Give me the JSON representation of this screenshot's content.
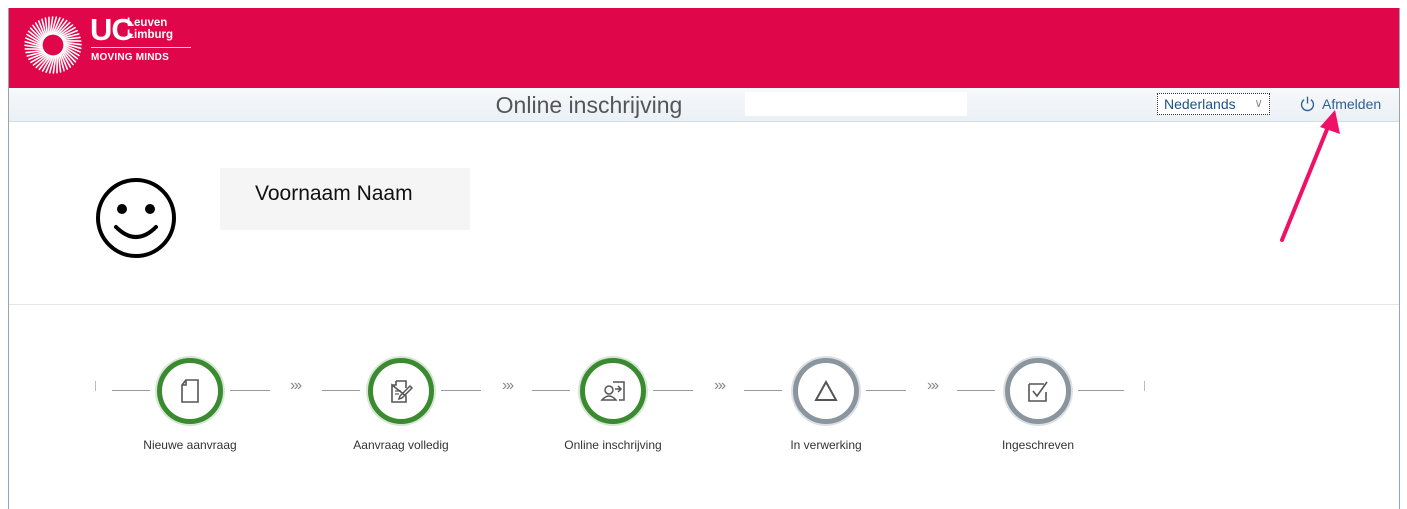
{
  "brand": {
    "short": "UC",
    "place_line1": "Leuven",
    "place_line2": "Limburg",
    "tagline": "MOVING MINDS",
    "color": "#e0064a"
  },
  "shell": {
    "title": "Online inschrijving",
    "language_selected": "Nederlands",
    "logout_label": "Afmelden"
  },
  "profile": {
    "name": "Voornaam Naam"
  },
  "steps": [
    {
      "label": "Nieuwe aanvraag",
      "status": "done",
      "icon": "document-icon"
    },
    {
      "label": "Aanvraag volledig",
      "status": "done",
      "icon": "document-edit-icon"
    },
    {
      "label": "Online inschrijving",
      "status": "done",
      "icon": "person-arrow-icon"
    },
    {
      "label": "In verwerking",
      "status": "todo",
      "icon": "triangle-icon"
    },
    {
      "label": "Ingeschreven",
      "status": "todo",
      "icon": "checkbox-icon"
    }
  ],
  "colors": {
    "done": "#3a8a2f",
    "todo": "#8b959e",
    "annotation_arrow": "#ee1166"
  }
}
